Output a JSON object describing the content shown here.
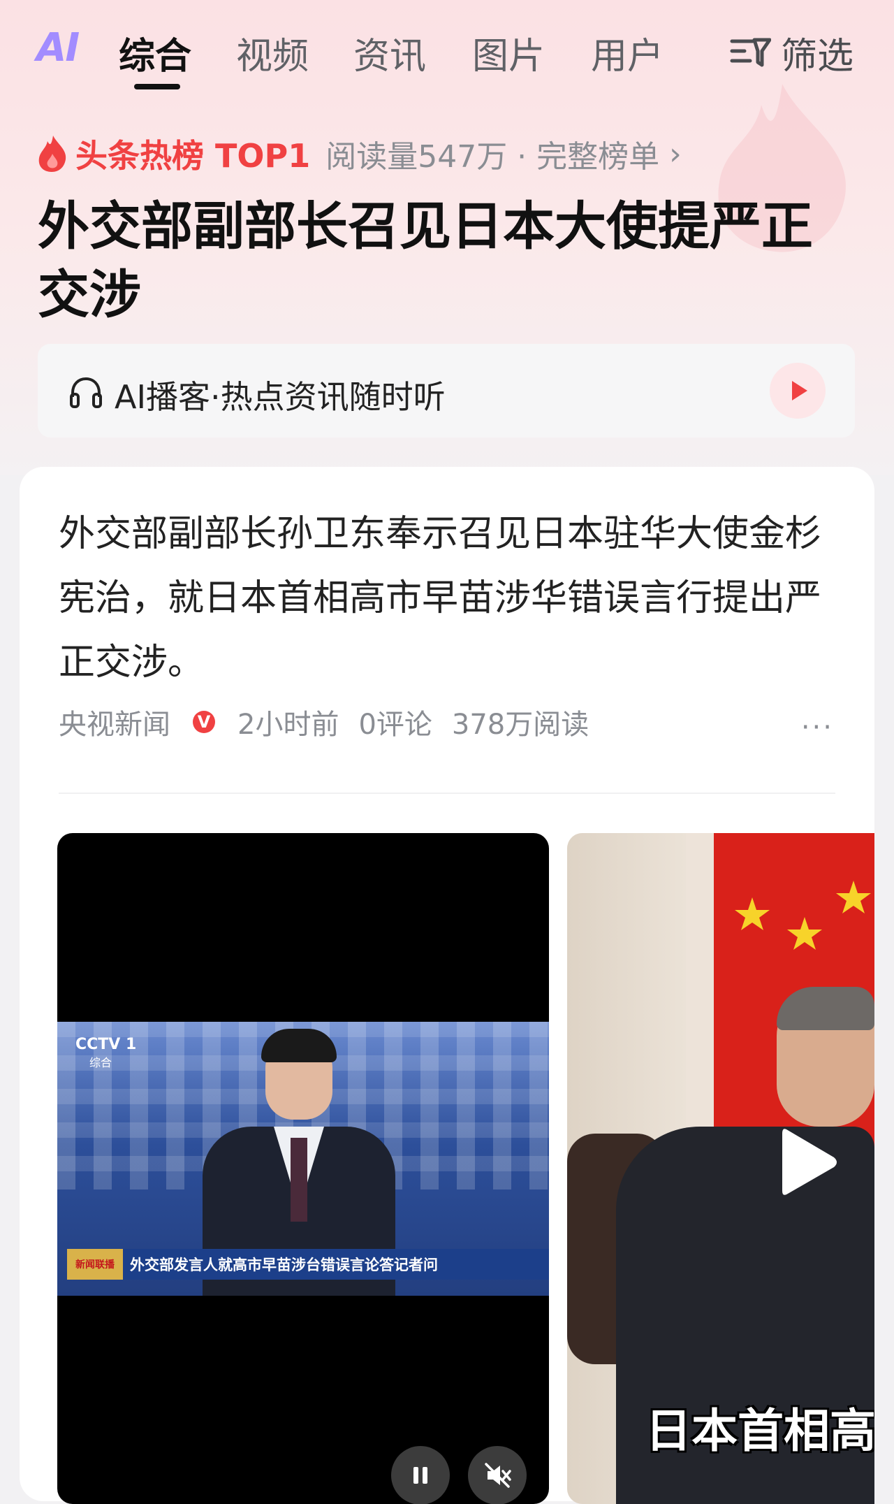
{
  "tabs": {
    "logo": "AI",
    "items": [
      {
        "label": "综合",
        "active": true
      },
      {
        "label": "视频",
        "active": false
      },
      {
        "label": "资讯",
        "active": false
      },
      {
        "label": "图片",
        "active": false
      },
      {
        "label": "用户",
        "active": false
      }
    ],
    "filter_label": "筛选"
  },
  "hot": {
    "icon": "flame-icon",
    "title": "头条热榜 TOP1",
    "meta": "阅读量547万 · 完整榜单",
    "chevron": "›"
  },
  "headline": "外交部副部长召见日本大使提严正交涉",
  "podcast": {
    "label": "AI播客·热点资讯随时听"
  },
  "article": {
    "text": "外交部副部长孙卫东奉示召见日本驻华大使金杉宪治，就日本首相高市早苗涉华错误言行提出严正交涉。",
    "source": "央视新闻",
    "verified_badge": "V",
    "time": "2小时前",
    "comments": "0评论",
    "reads": "378万阅读",
    "more": "···"
  },
  "video": {
    "channel_logo": "CCTV 1",
    "channel_sub": "综合",
    "lower_third_logo": "新闻联播",
    "lower_third": "外交部发言人就高市早苗涉台错误言论答记者问"
  },
  "photo": {
    "caption": "日本首相高市"
  },
  "colors": {
    "accent_red": "#f04142",
    "hero_bg": "#fbe1e4"
  }
}
